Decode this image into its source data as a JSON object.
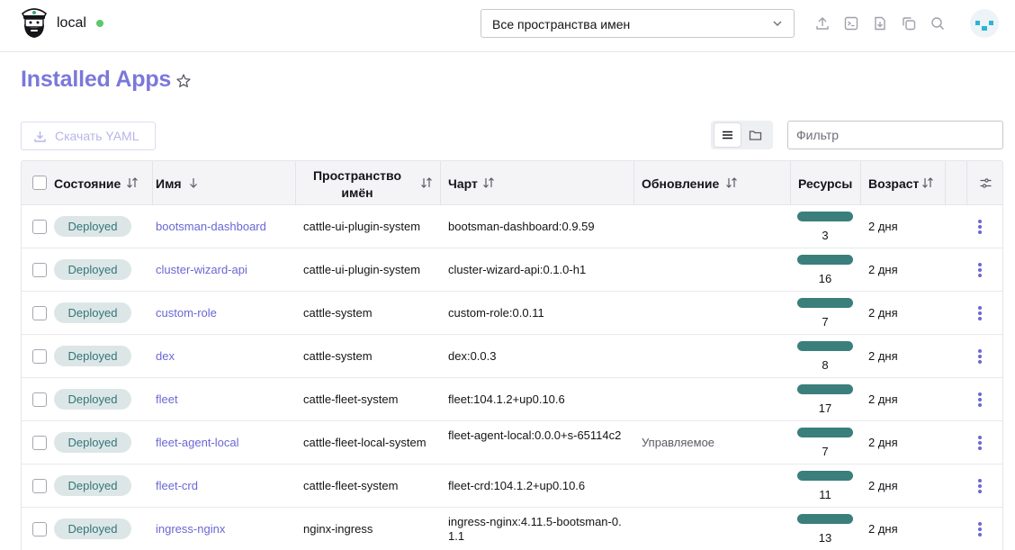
{
  "header": {
    "cluster_name": "local",
    "namespace_select_value": "Все пространства имен"
  },
  "page": {
    "title": "Installed Apps"
  },
  "toolbar": {
    "download_yaml_label": "Скачать YAML",
    "filter_placeholder": "Фильтр"
  },
  "table": {
    "columns": {
      "state": "Состояние",
      "name": "Имя",
      "namespace": "Пространство имён",
      "chart": "Чарт",
      "upgrade": "Обновление",
      "resources": "Ресурсы",
      "age": "Возраст"
    },
    "rows": [
      {
        "state": "Deployed",
        "name": "bootsman-dashboard",
        "namespace": "cattle-ui-plugin-system",
        "chart": "bootsman-dashboard:0.9.59",
        "upgrade": "",
        "resources": "3",
        "age": "2 дня"
      },
      {
        "state": "Deployed",
        "name": "cluster-wizard-api",
        "namespace": "cattle-ui-plugin-system",
        "chart": "cluster-wizard-api:0.1.0-h1",
        "upgrade": "",
        "resources": "16",
        "age": "2 дня"
      },
      {
        "state": "Deployed",
        "name": "custom-role",
        "namespace": "cattle-system",
        "chart": "custom-role:0.0.11",
        "upgrade": "",
        "resources": "7",
        "age": "2 дня"
      },
      {
        "state": "Deployed",
        "name": "dex",
        "namespace": "cattle-system",
        "chart": "dex:0.0.3",
        "upgrade": "",
        "resources": "8",
        "age": "2 дня"
      },
      {
        "state": "Deployed",
        "name": "fleet",
        "namespace": "cattle-fleet-system",
        "chart": "fleet:104.1.2+up0.10.6",
        "upgrade": "",
        "resources": "17",
        "age": "2 дня"
      },
      {
        "state": "Deployed",
        "name": "fleet-agent-local",
        "namespace": "cattle-fleet-local-system",
        "chart": "fleet-agent-local:0.0.0+s-65114c2",
        "upgrade": "Управляемое",
        "resources": "7",
        "age": "2 дня"
      },
      {
        "state": "Deployed",
        "name": "fleet-crd",
        "namespace": "cattle-fleet-system",
        "chart": "fleet-crd:104.1.2+up0.10.6",
        "upgrade": "",
        "resources": "11",
        "age": "2 дня"
      },
      {
        "state": "Deployed",
        "name": "ingress-nginx",
        "namespace": "nginx-ingress",
        "chart": "ingress-nginx:4.11.5-bootsman-0.1.1",
        "upgrade": "",
        "resources": "13",
        "age": "2 дня"
      }
    ]
  },
  "colors": {
    "accent": "#6a67d5",
    "badge_bg": "#dde6e6",
    "badge_text": "#31767a",
    "resource_bar": "#3a7f7c",
    "status_ok": "#5dc769"
  }
}
